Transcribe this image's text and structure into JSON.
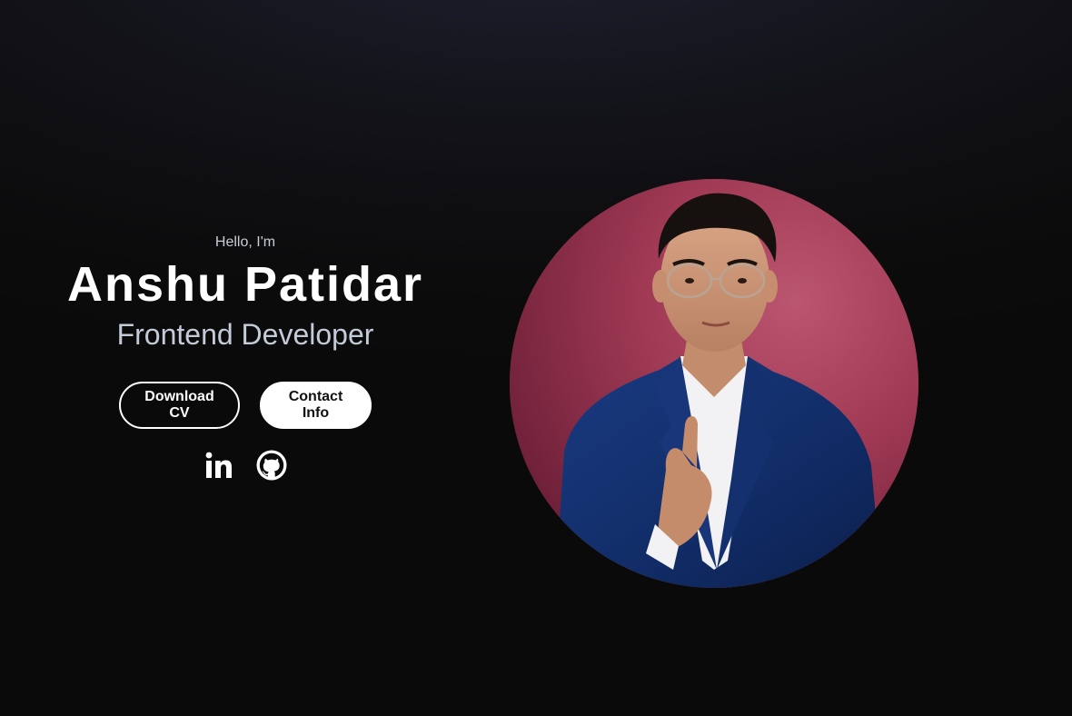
{
  "hero": {
    "greeting": "Hello, I'm",
    "name": "Anshu Patidar",
    "role": "Frontend Developer"
  },
  "buttons": {
    "download_cv": "Download CV",
    "contact_info": "Contact Info"
  },
  "socials": [
    {
      "icon": "linkedin-icon",
      "label": "LinkedIn"
    },
    {
      "icon": "github-icon",
      "label": "GitHub"
    }
  ],
  "portrait": {
    "alt": "Profile picture of Anshu Patidar",
    "background_color": "#9b3350",
    "suit_color": "#12306e"
  },
  "colors": {
    "background": "#0b0b0b",
    "text_primary": "#ffffff",
    "text_secondary": "#c3cad8",
    "accent": "#9b3350"
  }
}
